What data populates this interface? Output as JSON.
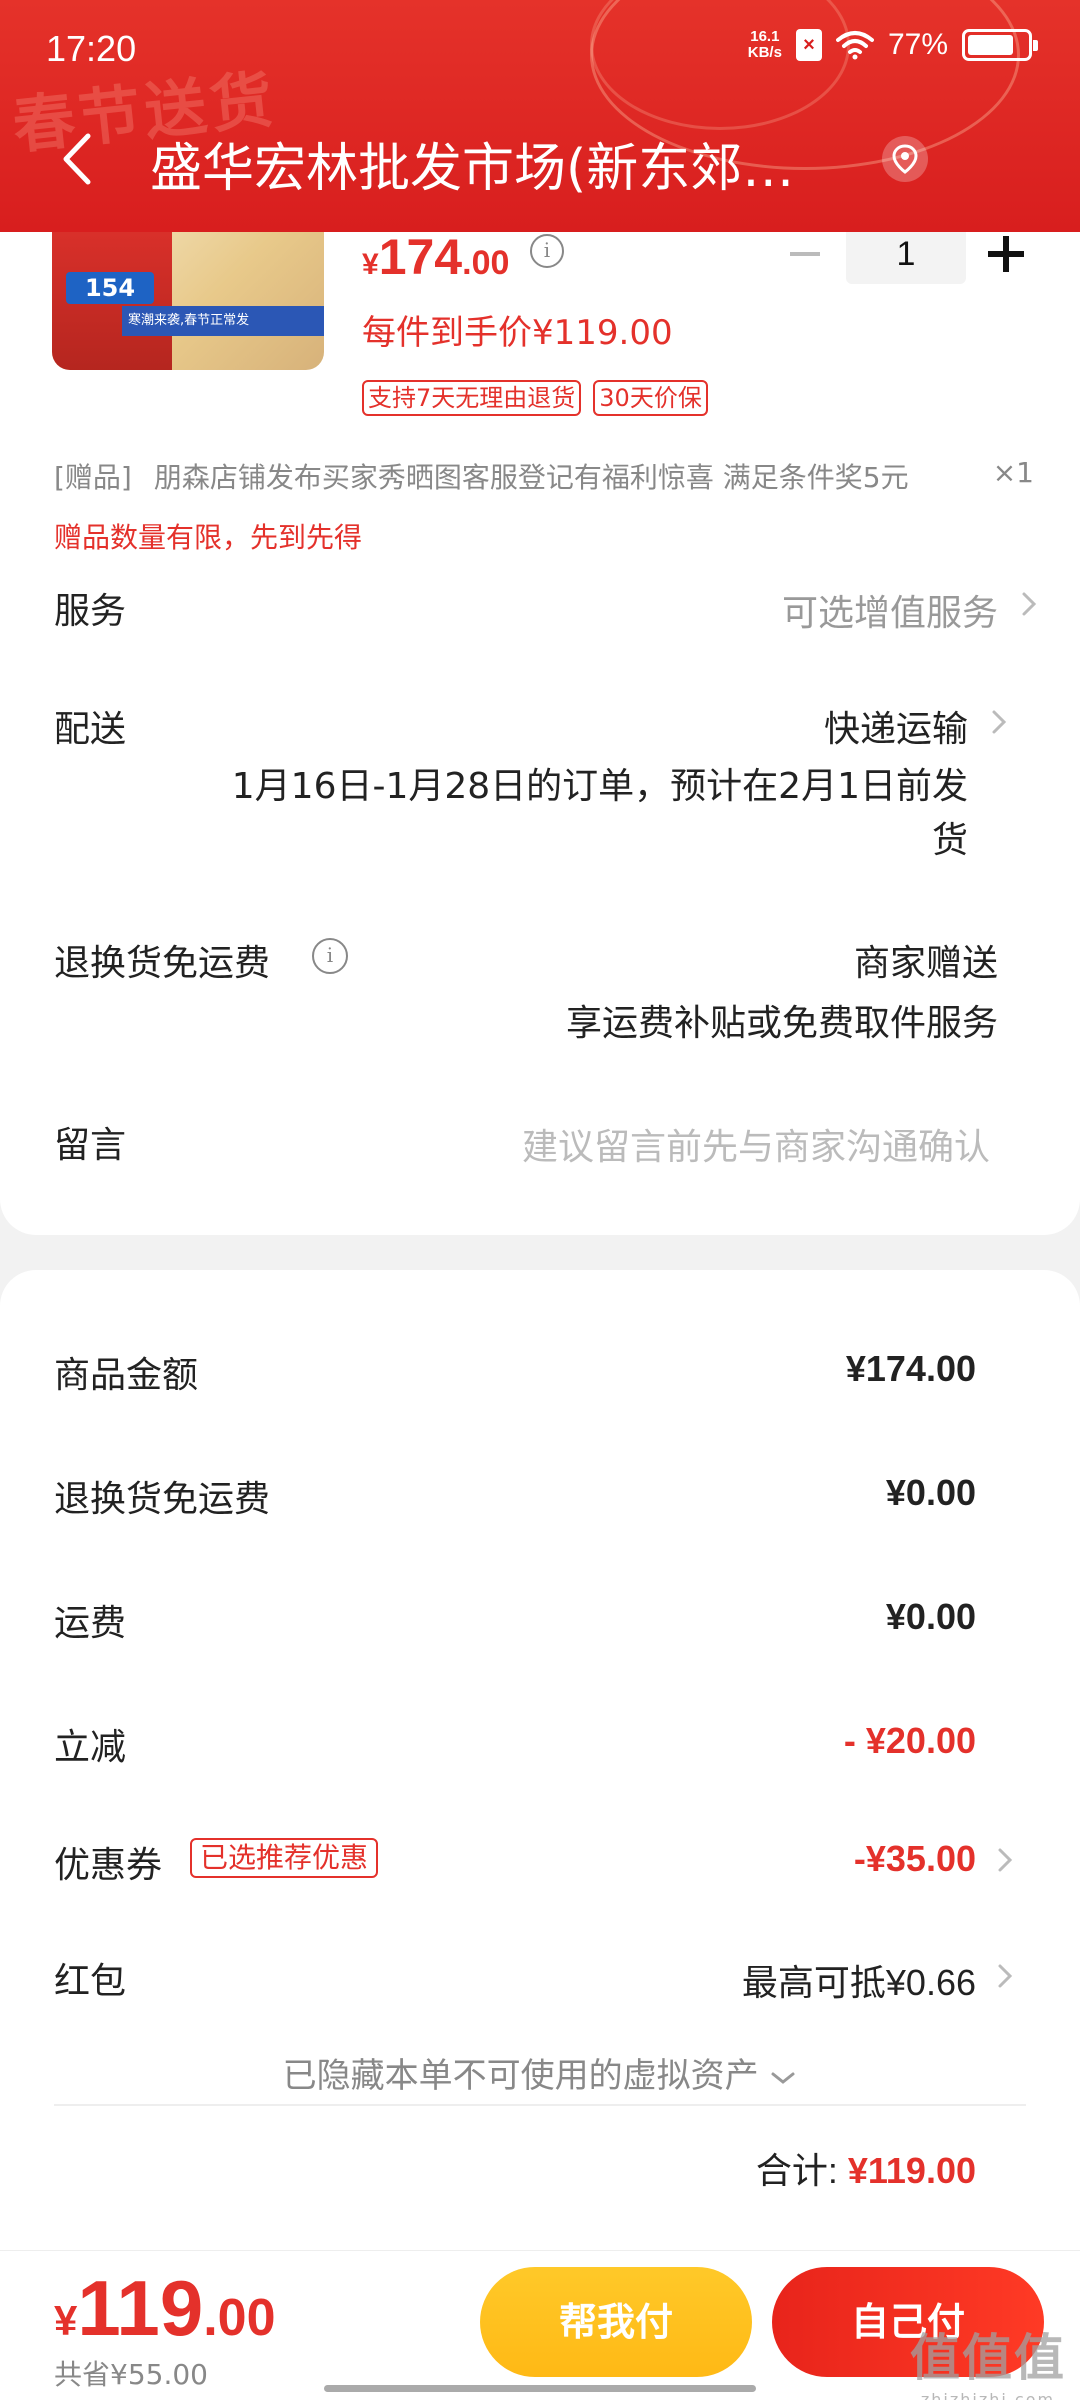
{
  "status_bar": {
    "time": "17:20",
    "net_speed_value": "16.1",
    "net_speed_unit": "KB/s",
    "battery_percent": "77%",
    "battery_level": 0.77
  },
  "header": {
    "store_title": "盛华宏林批发市场(新东郊…",
    "banner_text": "春节送货"
  },
  "product": {
    "image_price": "154",
    "image_band_text": "寒潮来袭,春节正常发",
    "price_symbol": "¥",
    "price_int": "174",
    "price_dec": ".00",
    "unit_price": "每件到手价¥119.00",
    "quantity": "1",
    "tags": [
      "支持7天无理由退货",
      "30天价保"
    ]
  },
  "gift": {
    "label": "[赠品]",
    "text": "朋森店铺发布买家秀晒图客服登记有福利惊喜 满足条件奖5元",
    "qty": "×1",
    "note": "赠品数量有限，先到先得"
  },
  "rows": {
    "service_label": "服务",
    "service_value": "可选增值服务",
    "delivery_label": "配送",
    "delivery_value": "快递运输",
    "delivery_note": "1月16日-1月28日的订单，预计在2月1日前发货",
    "return_label": "退换货免运费",
    "return_value": "商家赠送",
    "return_sub": "享运费补贴或免费取件服务",
    "message_label": "留言",
    "message_placeholder": "建议留言前先与商家沟通确认"
  },
  "summary": {
    "goods_label": "商品金额",
    "goods_value": "¥174.00",
    "return_fee_label": "退换货免运费",
    "return_fee_value": "¥0.00",
    "shipping_label": "运费",
    "shipping_value": "¥0.00",
    "discount_label": "立减",
    "discount_value": "- ¥20.00",
    "coupon_label": "优惠券",
    "coupon_badge": "已选推荐优惠",
    "coupon_value": "-¥35.00",
    "redpacket_label": "红包",
    "redpacket_value": "最高可抵¥0.66",
    "hidden_assets": "已隐藏本单不可使用的虚拟资产",
    "total_label": "合计:",
    "total_value": "¥119.00"
  },
  "bottom": {
    "pay_symbol": "¥",
    "pay_int": "119",
    "pay_dec": ".00",
    "saved": "共省¥55.00",
    "help_pay_label": "帮我付",
    "self_pay_label": "自己付"
  },
  "watermark": {
    "main": "值值值",
    "sub": "zhizhizhi.com"
  },
  "colors": {
    "accent_red": "#e4312b",
    "help_button": "#ffbe1c",
    "pay_button": "#f02a1f"
  }
}
